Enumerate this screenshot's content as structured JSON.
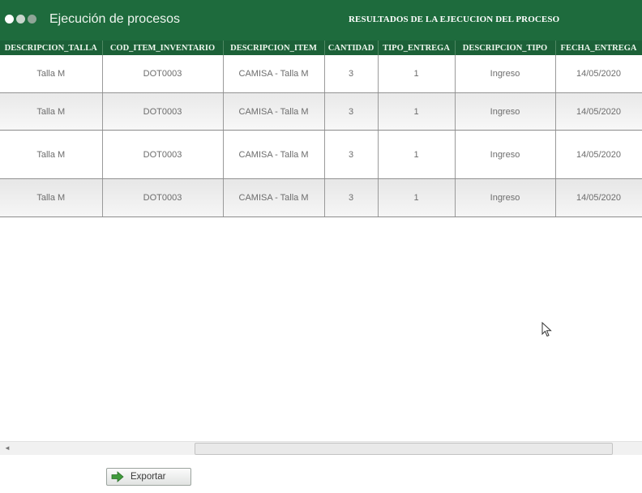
{
  "header": {
    "app_title": "Ejecución de procesos",
    "section_title": "RESULTADOS DE LA EJECUCION DEL PROCESO"
  },
  "table": {
    "columns": [
      "DESCRIPCION_TALLA",
      "COD_ITEM_INVENTARIO",
      "DESCRIPCION_ITEM",
      "CANTIDAD",
      "TIPO_ENTREGA",
      "DESCRIPCION_TIPO",
      "FECHA_ENTREGA"
    ],
    "rows": [
      [
        "Talla M",
        "DOT0003",
        "CAMISA - Talla M",
        "3",
        "1",
        "Ingreso",
        "14/05/2020"
      ],
      [
        "Talla M",
        "DOT0003",
        "CAMISA - Talla M",
        "3",
        "1",
        "Ingreso",
        "14/05/2020"
      ],
      [
        "Talla M",
        "DOT0003",
        "CAMISA - Talla M",
        "3",
        "1",
        "Ingreso",
        "14/05/2020"
      ],
      [
        "Talla M",
        "DOT0003",
        "CAMISA - Talla M",
        "3",
        "1",
        "Ingreso",
        "14/05/2020"
      ]
    ]
  },
  "footer": {
    "export_label": "Exportar"
  },
  "colors": {
    "header_bg": "#1e6b3d",
    "column_header_bg": "#1c6138",
    "export_arrow": "#3f9a3b"
  },
  "icons": {
    "export": "arrow-right-icon",
    "scroll_left": "arrow-left-icon",
    "cursor": "mouse-pointer-icon"
  }
}
